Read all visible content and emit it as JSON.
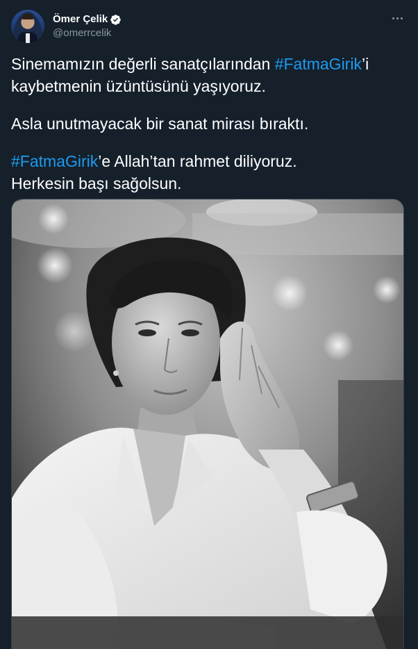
{
  "tweet": {
    "author": {
      "name": "Ömer Çelik",
      "handle": "@omerrcelik",
      "verified": true,
      "avatar_icon": "avatar-photo"
    },
    "more_icon": "more-horizontal-icon",
    "text": {
      "line1_before": "Sinemamızın değerli sanatçılarından ",
      "line1_hashtag": "#FatmaGirik",
      "line1_after": "’i",
      "line2": "kaybetmenin üzüntüsünü yaşıyoruz.",
      "line3": "Asla unutmayacak bir sanat mirası bıraktı.",
      "line4_hashtag": "#FatmaGirik",
      "line4_after": "’e Allah’tan rahmet diliyoruz.",
      "line5": "Herkesin başı sağolsun."
    },
    "media": {
      "type": "photo",
      "style": "black-and-white portrait"
    }
  },
  "colors": {
    "background": "#15202b",
    "text": "#ffffff",
    "secondary_text": "#8b98a5",
    "hashtag": "#1d9bf0",
    "verified_badge": "#1d9bf0"
  }
}
